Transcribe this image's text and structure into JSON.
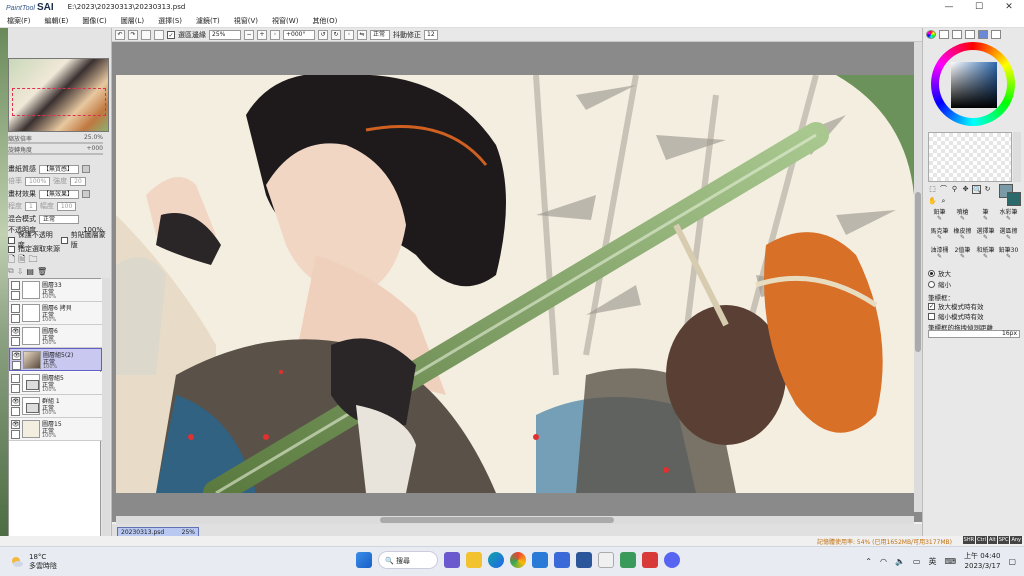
{
  "window": {
    "app_name_small": "PaintTool",
    "app_name": "SAI",
    "title": "E:\\2023\\20230313\\20230313.psd",
    "controls": [
      "—",
      "☐",
      "✕"
    ]
  },
  "menu": [
    "檔案(F)",
    "編輯(E)",
    "圖像(C)",
    "圖層(L)",
    "選擇(S)",
    "濾鏡(T)",
    "視窗(V)",
    "視窗(W)",
    "其他(O)"
  ],
  "toolbar": {
    "checkbox_label": "選區邊緣",
    "zoom": "25%",
    "rotation": "+000°",
    "mode": "正常",
    "stabilizer_label": "抖動修正",
    "stabilizer_value": "12"
  },
  "left_panel": {
    "zoom_label": "縮放倍率",
    "zoom_value": "25.0%",
    "angle_label": "旋轉角度",
    "angle_value": "+000",
    "texture_label": "畫紙質感",
    "texture_value": "【無質感】",
    "scale_label": "倍率",
    "scale_value": "100%",
    "strength_label": "強度",
    "strength_value": "20",
    "effect_label": "畫材效果",
    "effect_value": "【無效果】",
    "degree_label": "程度",
    "degree_value": "1",
    "width_label": "幅度",
    "width_value": "100",
    "blend_label": "混合模式",
    "blend_value": "正常",
    "opacity_label": "不透明度",
    "opacity_value": "100%",
    "opt1": "保護不透明度",
    "opt2": "剪貼圖層蒙版",
    "opt3": "指定選取來源",
    "layers": [
      {
        "name": "圖層33",
        "mode": "正常",
        "opacity": "100%",
        "type": "layer",
        "visible": false
      },
      {
        "name": "圖層6 拷貝",
        "mode": "正常",
        "opacity": "100%",
        "type": "layer",
        "visible": false
      },
      {
        "name": "圖層6",
        "mode": "正常",
        "opacity": "100%",
        "type": "layer",
        "visible": true
      },
      {
        "name": "圖層組5(2)",
        "mode": "正常",
        "opacity": "100%",
        "type": "layer",
        "visible": true
      },
      {
        "name": "圖層組5",
        "mode": "正常",
        "opacity": "100%",
        "type": "folder",
        "visible": false
      },
      {
        "name": "群組 1",
        "mode": "正常",
        "opacity": "100%",
        "type": "folder",
        "visible": true
      },
      {
        "name": "圖層15",
        "mode": "正常",
        "opacity": "100%",
        "type": "layer",
        "visible": true
      }
    ]
  },
  "doc_tab": {
    "name": "20230313.psd",
    "zoom": "25%"
  },
  "right_panel": {
    "brushes": [
      "鉛筆",
      "噴槍",
      "筆",
      "水彩筆",
      "馬克筆",
      "橡皮擦",
      "選擇筆",
      "選區擦",
      "油漆桶",
      "2值筆",
      "和紙筆",
      "鉛筆30"
    ],
    "zoom_in": "放大",
    "zoom_out": "縮小",
    "brush_frame_label": "筆標框：",
    "opt_enlarge": "放大模式時有效",
    "opt_shrink": "縮小模式時有效",
    "drag_label": "筆標框的拖拽偵測距離",
    "drag_value": "16px"
  },
  "status": {
    "memory": "記憶體使用率: 54% (已用1652MB/可用3177MB)",
    "keys": [
      "SHR",
      "Ctrl",
      "Alt",
      "SPC",
      "Any"
    ]
  },
  "taskbar": {
    "temp": "18°C",
    "weather": "多雲時陰",
    "search": "搜尋",
    "lang": "英",
    "time_top": "上午 04:40",
    "date": "2023/3/17"
  },
  "colors": {
    "accent": "#2e6ab0",
    "selected_layer": "#c8c8f0",
    "memory_text": "#c07010"
  }
}
